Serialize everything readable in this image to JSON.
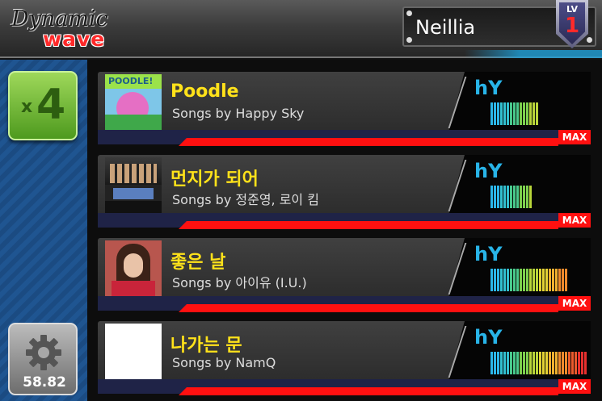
{
  "header": {
    "logo_top": "Dynamic",
    "logo_bottom": "wave",
    "player_name": "Neillia",
    "level_label": "LV",
    "level_value": "1"
  },
  "sidebar": {
    "multiplier_prefix": "x",
    "multiplier_value": "4",
    "speed_value": "58.82"
  },
  "songs": [
    {
      "title": "Poodle",
      "artist": "Songs by Happy Sky",
      "progress_label": "MAX",
      "progress": 1.0,
      "cover_text": "POODLE!",
      "level_bars": 15
    },
    {
      "title": "먼지가 되어",
      "artist": "Songs by 정준영, 로이 킴",
      "progress_label": "MAX",
      "progress": 1.0,
      "level_bars": 13
    },
    {
      "title": "좋은 날",
      "artist": "Songs by 아이유 (I.U.)",
      "progress_label": "MAX",
      "progress": 1.0,
      "level_bars": 24
    },
    {
      "title": "나가는 문",
      "artist": "Songs by NamQ",
      "progress_label": "MAX",
      "progress": 1.0,
      "level_bars": 30
    }
  ],
  "colors": {
    "title": "#ffe21a",
    "progress": "#ff1010",
    "accent_blue": "#28b4e8"
  }
}
